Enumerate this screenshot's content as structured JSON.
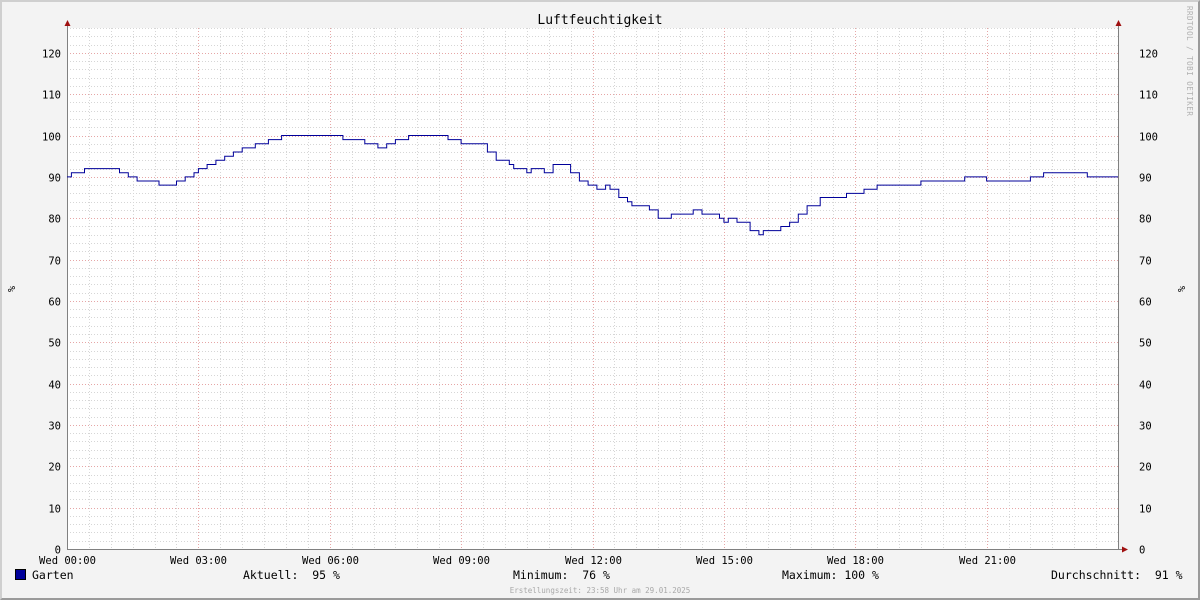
{
  "chart_data": {
    "type": "line",
    "title": "Luftfeuchtigkeit",
    "ylabel": "%",
    "ylabel_right": "%",
    "ylim": [
      0,
      126
    ],
    "yticks": [
      0,
      10,
      20,
      30,
      40,
      50,
      60,
      70,
      80,
      90,
      100,
      110,
      120
    ],
    "xlim": [
      "Wed 00:00",
      "Wed 23:58"
    ],
    "xticks": [
      "Wed 00:00",
      "Wed 03:00",
      "Wed 06:00",
      "Wed 09:00",
      "Wed 12:00",
      "Wed 15:00",
      "Wed 18:00",
      "Wed 21:00"
    ],
    "grid": true,
    "legend_position": "bottom",
    "series": [
      {
        "name": "Garten",
        "color": "#00009a",
        "x_hours": [
          0.0,
          0.1,
          0.2,
          0.4,
          0.8,
          1.2,
          1.4,
          1.6,
          1.8,
          2.1,
          2.3,
          2.5,
          2.7,
          2.9,
          3.0,
          3.2,
          3.4,
          3.6,
          3.8,
          4.0,
          4.3,
          4.6,
          4.9,
          5.2,
          5.8,
          6.3,
          6.5,
          6.8,
          7.1,
          7.3,
          7.5,
          7.8,
          8.1,
          8.4,
          8.7,
          9.0,
          9.3,
          9.6,
          9.8,
          10.0,
          10.1,
          10.2,
          10.5,
          10.6,
          10.8,
          10.9,
          11.1,
          11.3,
          11.5,
          11.7,
          11.9,
          12.1,
          12.3,
          12.4,
          12.6,
          12.8,
          12.9,
          13.0,
          13.3,
          13.5,
          13.8,
          14.0,
          14.3,
          14.5,
          14.7,
          14.9,
          15.0,
          15.1,
          15.3,
          15.4,
          15.6,
          15.8,
          15.9,
          16.1,
          16.3,
          16.5,
          16.7,
          16.9,
          17.2,
          17.8,
          18.2,
          18.5,
          19.0,
          19.5,
          20.0,
          20.5,
          21.0,
          21.5,
          22.0,
          22.3,
          22.5,
          22.8,
          23.0,
          23.3,
          23.6,
          23.98
        ],
        "values": [
          90,
          91,
          91,
          92,
          92,
          91,
          90,
          89,
          89,
          88,
          88,
          89,
          90,
          91,
          92,
          93,
          94,
          95,
          96,
          97,
          98,
          99,
          100,
          100,
          100,
          99,
          99,
          98,
          97,
          98,
          99,
          100,
          100,
          100,
          99,
          98,
          98,
          96,
          94,
          94,
          93,
          92,
          91,
          92,
          92,
          91,
          93,
          93,
          91,
          89,
          88,
          87,
          88,
          87,
          85,
          84,
          83,
          83,
          82,
          80,
          81,
          81,
          82,
          81,
          81,
          80,
          79,
          80,
          79,
          79,
          77,
          76,
          77,
          77,
          78,
          79,
          81,
          83,
          85,
          86,
          87,
          88,
          88,
          89,
          89,
          90,
          89,
          89,
          90,
          91,
          91,
          91,
          91,
          90,
          90,
          90
        ]
      }
    ]
  },
  "legend": {
    "series_name": "Garten",
    "aktuell_label": "Aktuell:",
    "aktuell_value": "95 %",
    "minimum_label": "Minimum:",
    "minimum_value": "76 %",
    "maximum_label": "Maximum:",
    "maximum_value": "100 %",
    "durchschnitt_label": "Durchschnitt:",
    "durchschnitt_value": "91 %"
  },
  "footer": "Erstellungszeit: 23:58 Uhr am 29.01.2025",
  "watermark": "RRDTOOL / TOBI OETIKER"
}
